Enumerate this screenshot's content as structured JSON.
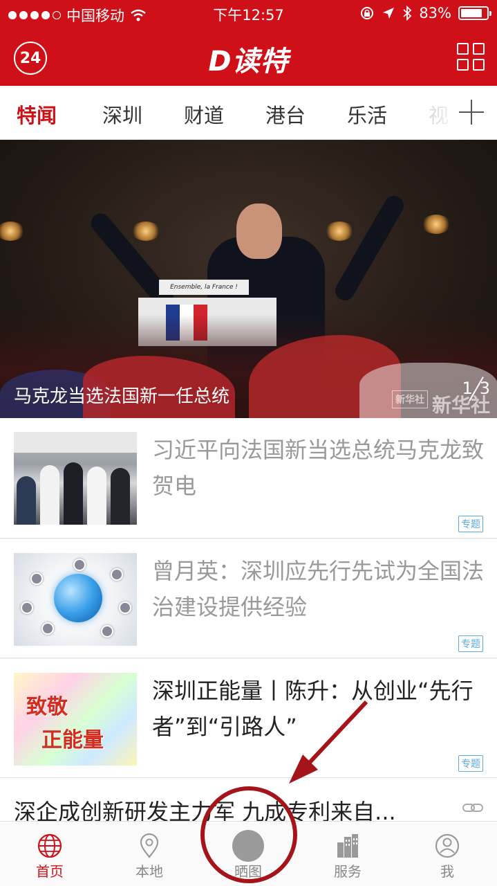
{
  "status_bar": {
    "carrier": "中国移动",
    "time": "下午12:57",
    "battery_percent_text": "83%",
    "battery_level": 0.83
  },
  "header": {
    "badge": "24",
    "logo": "D读特"
  },
  "tabs": [
    {
      "label": "特闻",
      "active": true
    },
    {
      "label": "深圳"
    },
    {
      "label": "财道"
    },
    {
      "label": "港台"
    },
    {
      "label": "乐活"
    },
    {
      "label": "视"
    }
  ],
  "hero": {
    "caption": "马克龙当选法国新一任总统",
    "pager_current": "1",
    "pager_total": "3",
    "watermark": "新华社",
    "podium_sign": "Ensemble, la France !"
  },
  "news": [
    {
      "title": "习近平向法国新当选总统马克龙致贺电",
      "tag": "专题"
    },
    {
      "title": "曾月英：深圳应先行先试为全国法治建设提供经验",
      "tag": "专题"
    },
    {
      "title": "深圳正能量丨陈升：从创业“先行者”到“引路人”",
      "tag": "专题",
      "thumb_text_1": "致敬",
      "thumb_text_2": "正能量"
    },
    {
      "title": "深企成创新研发主力军 九成专利来自..."
    }
  ],
  "bottom_nav": [
    {
      "label": "首页",
      "icon": "globe-icon",
      "active": true
    },
    {
      "label": "本地",
      "icon": "location-pin-icon"
    },
    {
      "label": "晒图",
      "icon": "camera-circle-icon"
    },
    {
      "label": "服务",
      "icon": "buildings-icon"
    },
    {
      "label": "我",
      "icon": "user-icon"
    }
  ],
  "colors": {
    "brand": "#cf1018",
    "tag": "#59a9e6",
    "annotation": "#a5141a"
  }
}
